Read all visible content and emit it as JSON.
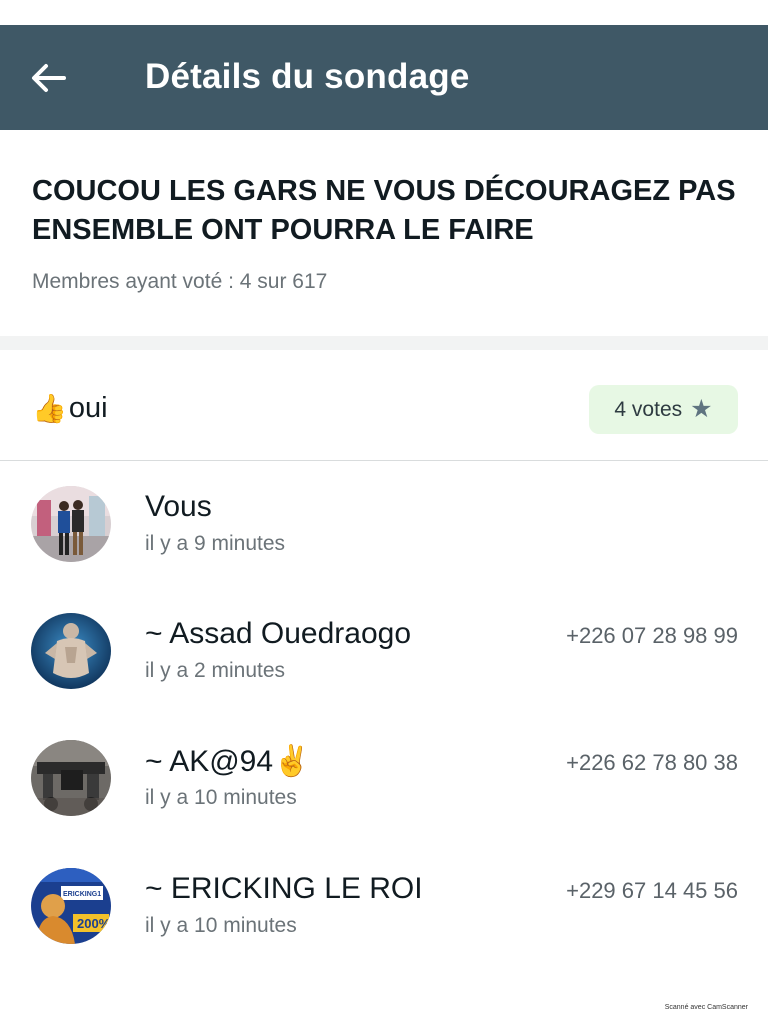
{
  "header": {
    "title": "Détails du sondage",
    "back_icon": "arrow-left-icon",
    "background": "#3f5866"
  },
  "poll": {
    "question": "COUCOU LES GARS NE VOUS DÉCOURAGEZ PAS ENSEMBLE ONT POURRA LE FAIRE",
    "voters_label": "Membres ayant voté",
    "voters_value": ": 4 sur 617"
  },
  "option": {
    "emoji": "👍",
    "label": "oui",
    "votes_label": "4 votes",
    "votes_icon": "star-icon",
    "badge_color": "#e7f8e4"
  },
  "voters": [
    {
      "name": "Vous",
      "time": "il y a 9 minutes",
      "phone": ""
    },
    {
      "name": "~ Assad Ouedraogo",
      "time": "il y a 2 minutes",
      "phone": "+226 07 28 98 99"
    },
    {
      "name": "~ AK@94✌️",
      "time": "il y a 10 minutes",
      "phone": "+226 62 78 80 38"
    },
    {
      "name": "~ ERICKING LE ROI",
      "time": "il y a 10 minutes",
      "phone": "+229 67 14 45 56"
    }
  ],
  "avatar_text": {
    "ericking_name": "ERICKING1",
    "ericking_percent": "200%"
  },
  "footer": {
    "scanner_text": "Scanné avec CamScanner"
  }
}
